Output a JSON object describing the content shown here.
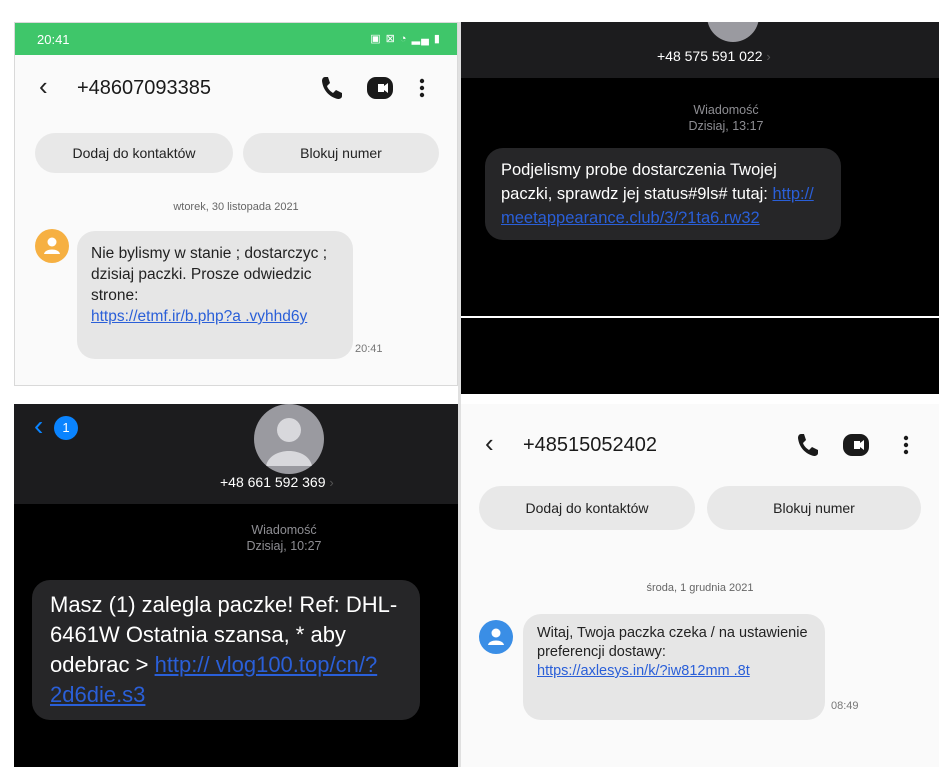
{
  "panel1": {
    "status_time": "20:41",
    "status_icons": "▣ ⊠ ◔ ▂▄ ▮",
    "contact": "+48607093385",
    "add_contact": "Dodaj do kontaktów",
    "block_number": "Blokuj numer",
    "date": "wtorek, 30 listopada 2021",
    "message_text": "Nie bylismy w stanie ; dostarczyc ; dzisiaj paczki. Prosze odwiedzic strone:",
    "message_link": "https://etmf.ir/b.php?a .vyhhd6y",
    "message_time": "20:41",
    "avatar_color": "#f6b042"
  },
  "panel2": {
    "contact": "+48 575 591 022",
    "chevron": "›",
    "meta_type": "Wiadomość",
    "meta_date": "Dzisiaj, 13:17",
    "message_text": "Podjelismy  probe dostarczenia Twojej paczki, sprawdz jej status#9ls# tutaj: ",
    "message_link": "http:// meetappearance.club/3/?1ta6.rw32"
  },
  "panel3": {
    "back_badge": "1",
    "contact": "+48 661 592 369",
    "chevron": "›",
    "meta_type": "Wiadomość",
    "meta_date": "Dzisiaj, 10:27",
    "message_text": "Masz (1) zalegla paczke! Ref: DHL-6461W Ostatnia szansa, * aby odebrac  > ",
    "message_link": "http:// vlog100.top/cn/?2d6die.s3"
  },
  "panel4": {
    "contact": "+48515052402",
    "add_contact": "Dodaj do kontaktów",
    "block_number": "Blokuj numer",
    "date": "środa, 1 grudnia 2021",
    "message_text": "Witaj, Twoja paczka czeka / na ustawienie preferencji dostawy:",
    "message_link": "https://axlesys.in/k/?iw812mm .8t",
    "message_time": "08:49",
    "avatar_color": "#3a8ee6"
  },
  "colors": {
    "samsung_status": "#3fc66a",
    "ios_blue": "#0a84ff",
    "link_blue": "#2a5fd8"
  }
}
